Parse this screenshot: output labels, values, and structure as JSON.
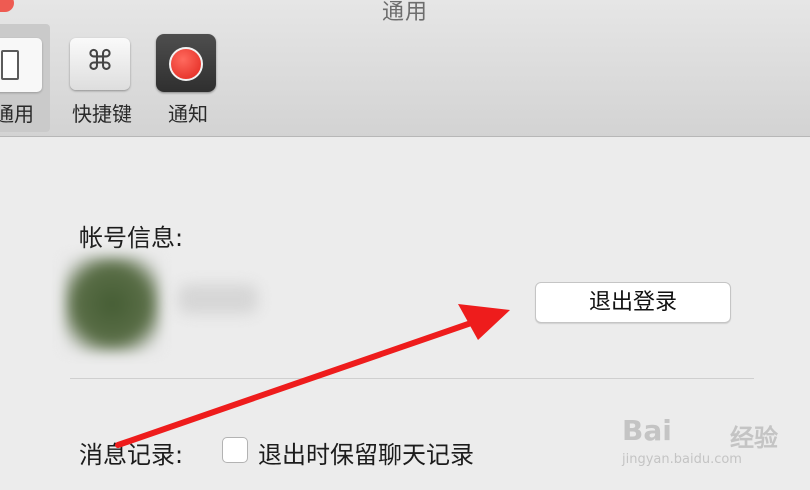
{
  "window": {
    "title": "通用"
  },
  "toolbar": {
    "tabs": [
      {
        "label": "通用",
        "icon": "toggle-switch-icon",
        "active": true
      },
      {
        "label": "快捷键",
        "icon": "command-key-icon",
        "glyph": "⌘",
        "active": false
      },
      {
        "label": "通知",
        "icon": "record-dot-icon",
        "active": false
      }
    ]
  },
  "account": {
    "label": "帐号信息:",
    "logout_label": "退出登录"
  },
  "history": {
    "label": "消息记录:",
    "checkbox_label": "退出时保留聊天记录",
    "checked": false
  },
  "watermark": {
    "brand": "Bai",
    "brand_suffix": "经验",
    "url": "jingyan.baidu.com"
  },
  "colors": {
    "annotation_arrow": "#ee1c1c",
    "close_button": "#ee5b52"
  }
}
